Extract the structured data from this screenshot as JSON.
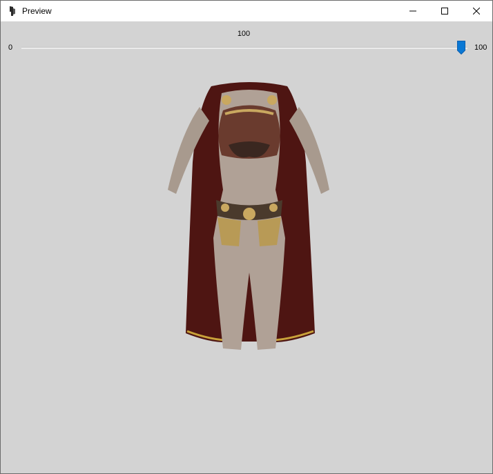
{
  "window": {
    "title": "Preview",
    "icon": "cubes-icon"
  },
  "controls": {
    "minimize": "minimize-icon",
    "maximize": "maximize-icon",
    "close": "close-icon"
  },
  "slider": {
    "min_label": "0",
    "max_label": "100",
    "current_label": "100",
    "value": 100,
    "min": 0,
    "max": 100
  },
  "colors": {
    "background": "#d3d3d3",
    "slider_accent": "#0a78d4",
    "titlebar": "#ffffff"
  }
}
